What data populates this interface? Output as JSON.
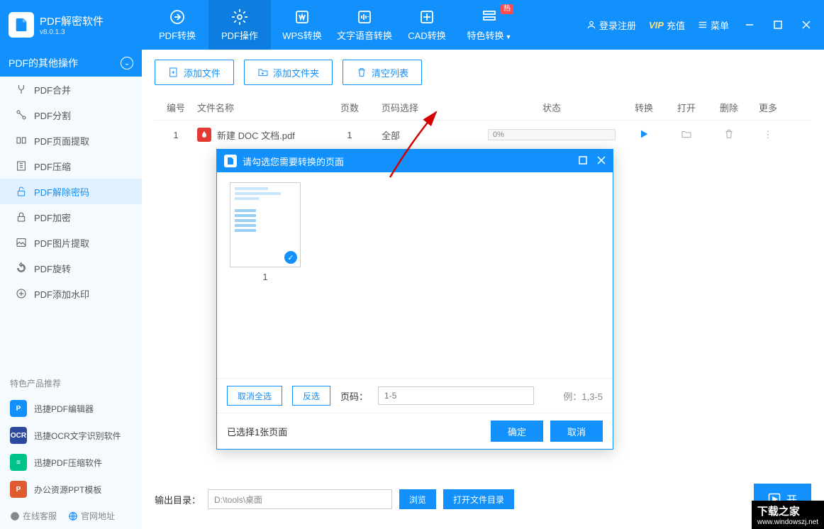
{
  "app": {
    "title": "PDF解密软件",
    "version": "v8.0.1.3"
  },
  "tabs": [
    {
      "label": "PDF转换"
    },
    {
      "label": "PDF操作"
    },
    {
      "label": "WPS转换"
    },
    {
      "label": "文字语音转换"
    },
    {
      "label": "CAD转换"
    },
    {
      "label": "特色转换",
      "badge": "热"
    }
  ],
  "header_right": {
    "login": "登录注册",
    "vip": "VIP",
    "recharge": "充值",
    "menu": "菜单"
  },
  "sidebar": {
    "title": "PDF的其他操作",
    "items": [
      {
        "label": "PDF合并"
      },
      {
        "label": "PDF分割"
      },
      {
        "label": "PDF页面提取"
      },
      {
        "label": "PDF压缩"
      },
      {
        "label": "PDF解除密码"
      },
      {
        "label": "PDF加密"
      },
      {
        "label": "PDF图片提取"
      },
      {
        "label": "PDF旋转"
      },
      {
        "label": "PDF添加水印"
      }
    ],
    "promo_title": "特色产品推荐",
    "promos": [
      {
        "label": "迅捷PDF编辑器",
        "color": "#1290fc",
        "tag": "P"
      },
      {
        "label": "迅捷OCR文字识别软件",
        "color": "#2b4a9e",
        "tag": "OCR"
      },
      {
        "label": "迅捷PDF压缩软件",
        "color": "#00c389",
        "tag": "≡"
      },
      {
        "label": "办公资源PPT模板",
        "color": "#e05a2f",
        "tag": "P"
      }
    ],
    "footer": {
      "support": "在线客服",
      "site": "官网地址"
    }
  },
  "actions": {
    "add_file": "添加文件",
    "add_folder": "添加文件夹",
    "clear": "清空列表"
  },
  "columns": {
    "num": "编号",
    "name": "文件名称",
    "pages": "页数",
    "select": "页码选择",
    "status": "状态",
    "convert": "转换",
    "open": "打开",
    "delete": "删除",
    "more": "更多"
  },
  "rows": [
    {
      "num": "1",
      "name": "新建 DOC 文档.pdf",
      "pages": "1",
      "select": "全部",
      "progress": "0%"
    }
  ],
  "output": {
    "label": "输出目录：",
    "path": "D:\\tools\\桌面",
    "browse": "浏览",
    "open_folder": "打开文件目录",
    "start": "开"
  },
  "modal": {
    "title": "请勾选您需要转换的页面",
    "thumb_num": "1",
    "deselect": "取消全选",
    "invert": "反选",
    "page_label": "页码：",
    "page_placeholder": "1-5",
    "example": "例：1,3-5",
    "selected": "已选择1张页面",
    "ok": "确定",
    "cancel": "取消"
  },
  "watermark": {
    "main": "下载之家",
    "sub": "www.windowszj.net"
  }
}
